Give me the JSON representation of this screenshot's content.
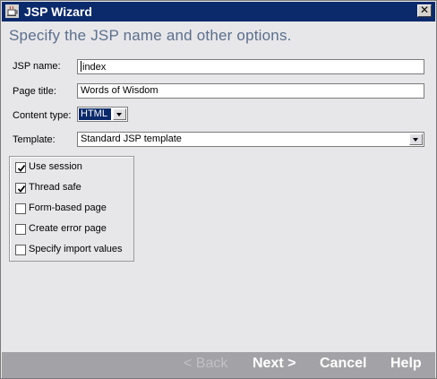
{
  "window": {
    "title": "JSP Wizard",
    "close_glyph": "✕",
    "app_icon": "jsp-coffee-icon"
  },
  "heading": "Specify the JSP name and other options.",
  "form": {
    "jsp_name": {
      "label": "JSP name:",
      "value": "index"
    },
    "page_title": {
      "label": "Page title:",
      "value": "Words of Wisdom"
    },
    "content_type": {
      "label": "Content type:",
      "value": "HTML"
    },
    "template": {
      "label": "Template:",
      "value": "Standard JSP template"
    }
  },
  "options": [
    {
      "label": "Use session",
      "checked": true
    },
    {
      "label": "Thread safe",
      "checked": true
    },
    {
      "label": "Form-based page",
      "checked": false
    },
    {
      "label": "Create error page",
      "checked": false
    },
    {
      "label": "Specify import values",
      "checked": false
    }
  ],
  "buttons": {
    "back": "< Back",
    "next": "Next >",
    "cancel": "Cancel",
    "help": "Help"
  },
  "colors": {
    "titlebar": "#0b2a6b",
    "heading": "#5c6f8c",
    "bottom_bar": "#a3a3a7"
  }
}
